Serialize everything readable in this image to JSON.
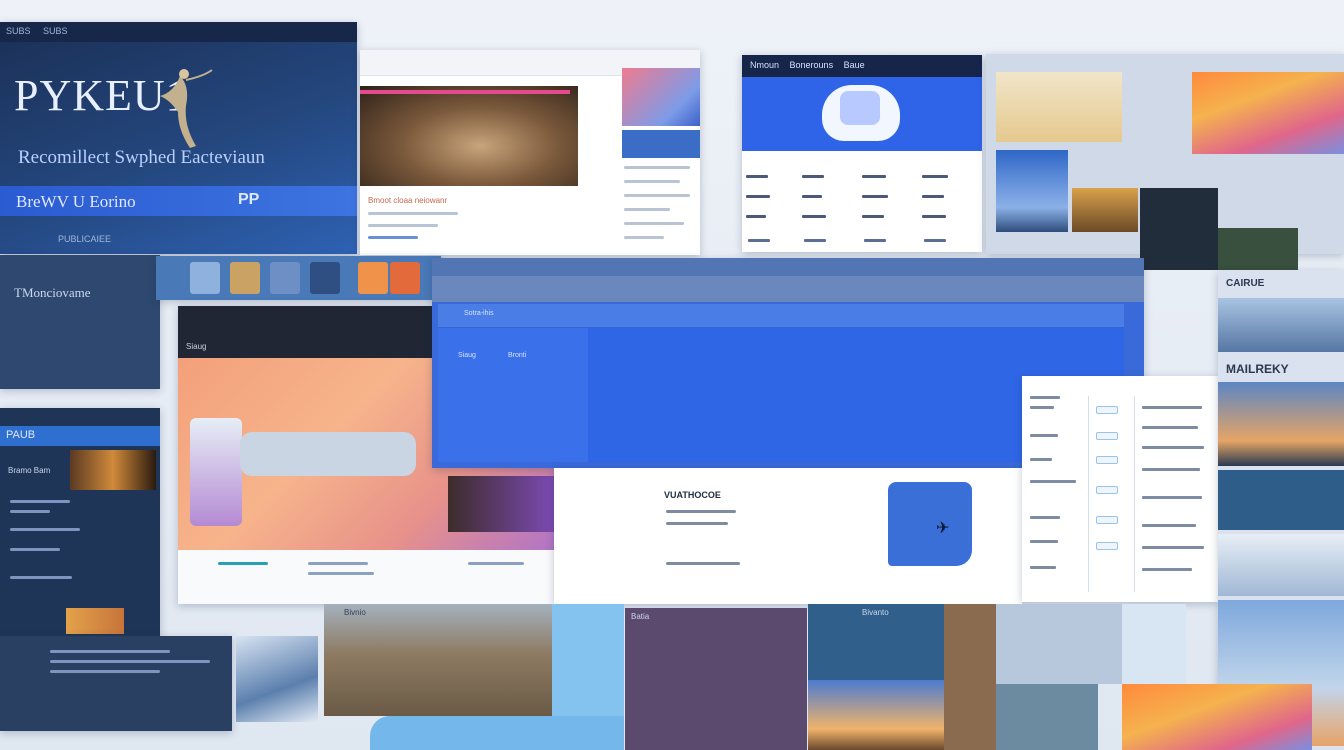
{
  "hero": {
    "logo_text": "PYKEU1",
    "subtitle": "Recomillect Swphed Eacteviaun",
    "bar_label": "BreWV U Eorino",
    "bar_right": "PP",
    "top_left": "SUBS",
    "top_right": "SUBS",
    "footer": "PUBLICAIEE"
  },
  "side_left": {
    "title": "TMonciovame"
  },
  "mid_left": {
    "header": "PAUB",
    "item": "Bramo Bam"
  },
  "browser1": {
    "caption": "Bmoot cloaa neiowanr"
  },
  "app_blue": {
    "nav_left": "Nmoun",
    "nav_mid": "Bonerouns",
    "nav_right": "Baue"
  },
  "app_main": {
    "search_label": "Sotra-ihis",
    "col_label_1": "Siaug",
    "col_label_2": "Bronti"
  },
  "page_white": {
    "title": "VUATHOCOE"
  },
  "right_col": {
    "label_1": "CAIRUE",
    "label_2": "MAILREKY"
  },
  "bottom": {
    "caption_1": "Bivnio",
    "caption_2": "Batia",
    "caption_3": "Bivanto"
  },
  "colors": {
    "hero_bg": "#24477e",
    "accent_blue": "#2f63e8",
    "orange_hero": "#f3a07a"
  }
}
